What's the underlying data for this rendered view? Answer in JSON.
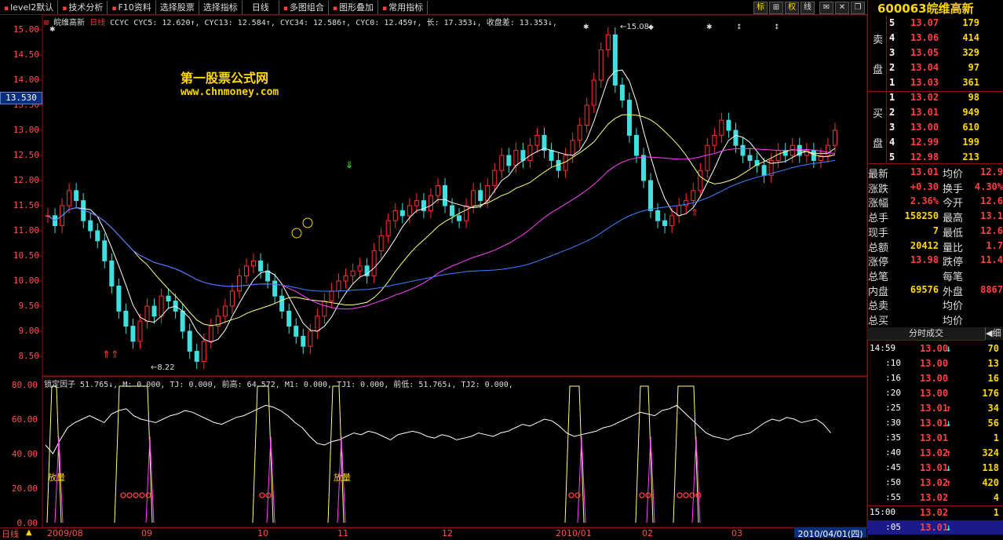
{
  "toolbar": {
    "items": [
      "level2默认",
      "技术分析",
      "F10资料",
      "选择股票",
      "选择指标",
      "日线",
      "多图组合",
      "图形叠加",
      "常用指标"
    ]
  },
  "chart": {
    "stock_name": "皖维高新",
    "period": "日线",
    "indicator_line": "CCYC CYC5: 12.620↑, CYC13: 12.584↑, CYC34: 12.586↑, CYC0: 12.459↑, 长: 17.353↓, 收盘差: 13.353↓,",
    "current_price_label": "13.530",
    "watermark_title": "第一股票公式网",
    "watermark_url": "www.chnmoney.com",
    "high_label": "15.08",
    "low_label": "8.22",
    "price_axis": [
      "15.00",
      "14.50",
      "14.00",
      "13.50",
      "13.00",
      "12.50",
      "12.00",
      "11.50",
      "11.00",
      "10.50",
      "10.00",
      "9.50",
      "9.00",
      "8.50"
    ],
    "sub_indicator": "锁定因子 51.765↓, M: 0.000, TJ: 0.000, 前高: 64.572, M1: 0.000, TJ1: 0.000, 前低: 51.765↓, TJ2: 0.000,",
    "sub_axis": [
      "80.00",
      "60.00",
      "40.00",
      "20.00",
      "0.00"
    ],
    "fangliang": "放量",
    "date_axis": [
      "2009/08",
      "09",
      "10",
      "11",
      "12",
      "2010/01",
      "02",
      "03"
    ],
    "current_date": "2010/04/01(四)",
    "period_button": "日线",
    "colors": {
      "up": "#ff3030",
      "down": "#40e0e0",
      "cyc5": "#ffffff",
      "cyc13": "#ffff80",
      "cyc34": "#ff40ff",
      "cyc0": "#4080ff"
    }
  },
  "quote": {
    "code": "600063",
    "name": "皖维高新",
    "top_icons": [
      "标",
      "⊞",
      "权",
      "线",
      "✉",
      "✕",
      "❐"
    ],
    "sell_label": [
      "卖",
      "盘"
    ],
    "buy_label": [
      "买",
      "盘"
    ],
    "asks": [
      {
        "level": "5",
        "price": "13.07",
        "vol": "179"
      },
      {
        "level": "4",
        "price": "13.06",
        "vol": "414"
      },
      {
        "level": "3",
        "price": "13.05",
        "vol": "329"
      },
      {
        "level": "2",
        "price": "13.04",
        "vol": "97"
      },
      {
        "level": "1",
        "price": "13.03",
        "vol": "361"
      }
    ],
    "bids": [
      {
        "level": "1",
        "price": "13.02",
        "vol": "98"
      },
      {
        "level": "2",
        "price": "13.01",
        "vol": "949"
      },
      {
        "level": "3",
        "price": "13.00",
        "vol": "610"
      },
      {
        "level": "4",
        "price": "12.99",
        "vol": "199"
      },
      {
        "level": "5",
        "price": "12.98",
        "vol": "213"
      }
    ],
    "stats": [
      {
        "l": "最新",
        "v": "13.01",
        "l2": "均价",
        "v2": "12.9"
      },
      {
        "l": "涨跌",
        "v": "+0.30",
        "l2": "换手",
        "v2": "4.30%"
      },
      {
        "l": "涨幅",
        "v": "2.36%",
        "l2": "今开",
        "v2": "12.6"
      },
      {
        "l": "总手",
        "v": "158250",
        "l2": "最高",
        "v2": "13.1"
      },
      {
        "l": "现手",
        "v": "7",
        "l2": "最低",
        "v2": "12.6"
      },
      {
        "l": "总额",
        "v": "20412",
        "l2": "量比",
        "v2": "1.7"
      },
      {
        "l": "涨停",
        "v": "13.98",
        "l2": "跌停",
        "v2": "11.4"
      },
      {
        "l": "总笔",
        "v": "",
        "l2": "每笔",
        "v2": ""
      },
      {
        "l": "内盘",
        "v": "69576",
        "l2": "外盘",
        "v2": "8867"
      },
      {
        "l": "总卖",
        "v": "",
        "l2": "均价",
        "v2": ""
      },
      {
        "l": "总买",
        "v": "",
        "l2": "均价",
        "v2": ""
      }
    ],
    "ticks_header": "分时成交",
    "ticks_tab2": "细",
    "ticks": [
      {
        "t": "14:59",
        "p": "13.00",
        "d": "↓",
        "v": "70"
      },
      {
        "t": ":10",
        "p": "13.00",
        "d": "",
        "v": "13"
      },
      {
        "t": ":16",
        "p": "13.00",
        "d": "",
        "v": "16"
      },
      {
        "t": ":20",
        "p": "13.00",
        "d": "",
        "v": "176"
      },
      {
        "t": ":25",
        "p": "13.01",
        "d": "↑",
        "v": "34"
      },
      {
        "t": ":30",
        "p": "13.01",
        "d": "↓",
        "v": "56"
      },
      {
        "t": ":35",
        "p": "13.01",
        "d": "",
        "v": "1"
      },
      {
        "t": ":40",
        "p": "13.02",
        "d": "↑",
        "v": "324"
      },
      {
        "t": ":45",
        "p": "13.01",
        "d": "↓",
        "v": "118"
      },
      {
        "t": ":50",
        "p": "13.02",
        "d": "↑",
        "v": "420"
      },
      {
        "t": ":55",
        "p": "13.02",
        "d": "",
        "v": "4"
      },
      {
        "t": "15:00",
        "p": "13.02",
        "d": "",
        "v": "1"
      },
      {
        "t": ":05",
        "p": "13.01",
        "d": "↓",
        "v": ""
      }
    ]
  }
}
